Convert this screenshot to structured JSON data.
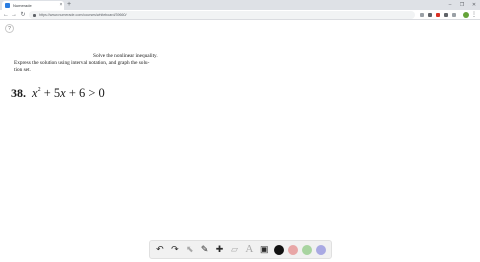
{
  "browser": {
    "tab_title": "Numerade",
    "tab_close": "×",
    "new_tab": "+",
    "url": "https://www.numerade.com/courses/whiteboard/39660/",
    "window_controls": {
      "minimize": "–",
      "maximize": "❐",
      "close": "✕"
    },
    "nav": {
      "back": "←",
      "forward": "→",
      "reload": "↻"
    },
    "menu_glyph": "⋮",
    "accent": "#2a7de1"
  },
  "page": {
    "help_glyph": "?",
    "instruction_line1": "Solve the nonlinear inequality.",
    "instruction_line2": "Express the solution using interval notation, and graph the solu-",
    "instruction_line3": "tion set.",
    "problem_number": "38.",
    "expression": {
      "var1": "x",
      "exp": "2",
      "rest": " + 5",
      "var2": "x",
      "tail": " + 6 > 0"
    }
  },
  "toolbar": {
    "undo_icon": "↶",
    "redo_icon": "↷",
    "pointer_icon": "⬉",
    "pen_icon": "✎",
    "add_icon": "✚",
    "eraser_icon": "▱",
    "text_icon": "A",
    "image_icon": "▣",
    "colors": [
      "#111111",
      "#e8a6a6",
      "#a8d4a0",
      "#a9a9e3"
    ]
  }
}
